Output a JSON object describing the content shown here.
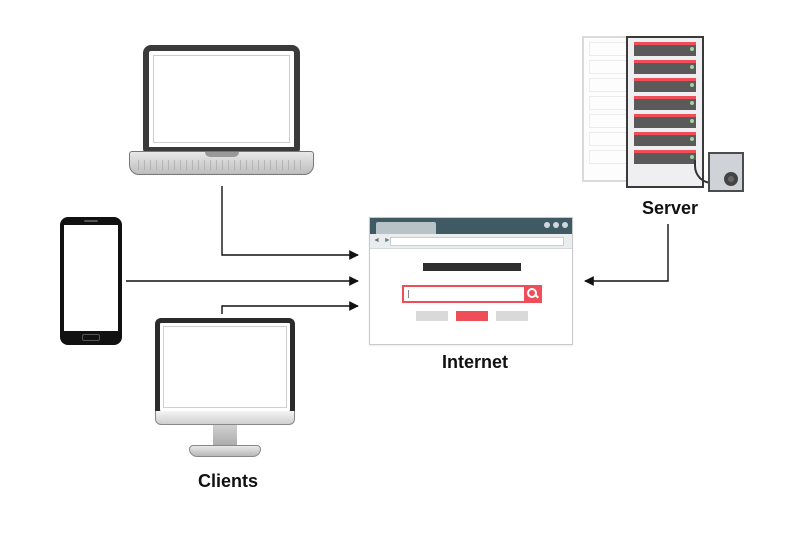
{
  "labels": {
    "clients": "Clients",
    "internet": "Internet",
    "server": "Server"
  },
  "nodes": {
    "laptop": {
      "role": "client",
      "kind": "laptop"
    },
    "phone": {
      "role": "client",
      "kind": "smartphone"
    },
    "desktop": {
      "role": "client",
      "kind": "desktop-monitor"
    },
    "browser": {
      "role": "internet",
      "kind": "web-browser"
    },
    "server": {
      "role": "server",
      "kind": "server-rack"
    }
  },
  "connections": [
    {
      "from": "laptop",
      "to": "browser",
      "direction": "to"
    },
    {
      "from": "phone",
      "to": "browser",
      "direction": "to"
    },
    {
      "from": "desktop",
      "to": "browser",
      "direction": "to"
    },
    {
      "from": "server",
      "to": "browser",
      "direction": "to"
    }
  ],
  "icons": {
    "search": "search-icon",
    "browser_nav": "◄ ►"
  },
  "colors": {
    "accent_red": "#ef4d57",
    "chrome_dark": "#3f5a62",
    "device_dark": "#2b2b2b",
    "light_gray": "#d9d9d9"
  }
}
